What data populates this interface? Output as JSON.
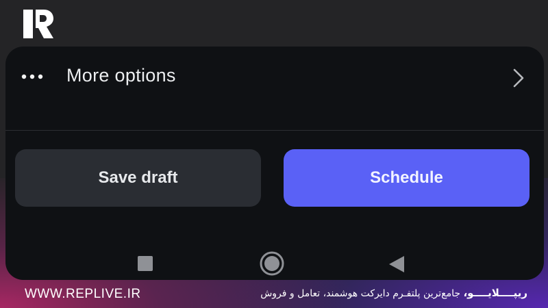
{
  "logo": {
    "icon": "replive-logo-icon"
  },
  "more_options": {
    "label": "More options",
    "leading_icon": "more-horizontal-icon",
    "trailing_icon": "chevron-right-icon"
  },
  "actions": {
    "save_draft": "Save draft",
    "schedule": "Schedule"
  },
  "colors": {
    "background": "#242426",
    "panel": "#0f1114",
    "save_button": "#2a2d33",
    "schedule_button": "#5a61f6"
  },
  "nav": {
    "recents_icon": "square-icon",
    "home_icon": "circle-icon",
    "back_icon": "triangle-left-icon"
  },
  "footer": {
    "url": "WWW.REPLIVE.IR",
    "brand": "ریپــــلایــــو،",
    "tagline": "جامع‌ترین پلتفـرم دایرکت هوشمند، تعامل و فروش"
  }
}
